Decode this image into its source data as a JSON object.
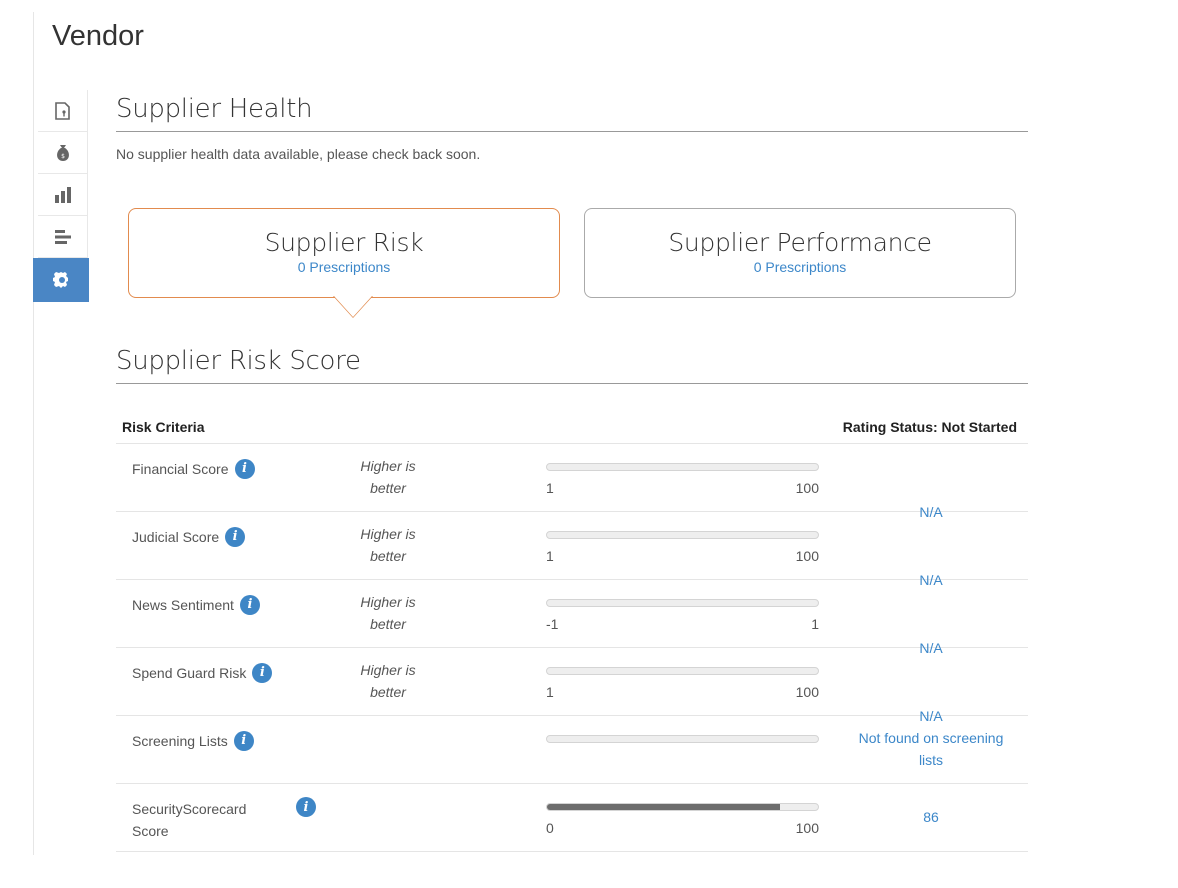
{
  "page": {
    "title": "Vendor"
  },
  "sidebar": {
    "items": [
      {
        "icon": "document-icon"
      },
      {
        "icon": "money-bag-icon"
      },
      {
        "icon": "bar-chart-icon"
      },
      {
        "icon": "horizontal-bars-icon"
      },
      {
        "icon": "gear-icon",
        "active": true
      }
    ]
  },
  "health": {
    "title": "Supplier Health",
    "note": "No supplier health data available, please check back soon."
  },
  "cards": {
    "risk": {
      "title": "Supplier Risk",
      "link": "0 Prescriptions"
    },
    "performance": {
      "title": "Supplier Performance",
      "link": "0 Prescriptions"
    }
  },
  "risk_score": {
    "title": "Supplier Risk Score",
    "header_left": "Risk Criteria",
    "header_right": "Rating Status: Not Started",
    "rows": [
      {
        "name": "Financial Score",
        "hint_line1": "Higher is",
        "hint_line2": "better",
        "min": "1",
        "max": "100",
        "fill": 0,
        "value": "N/A"
      },
      {
        "name": "Judicial Score",
        "hint_line1": "Higher is",
        "hint_line2": "better",
        "min": "1",
        "max": "100",
        "fill": 0,
        "value": "N/A"
      },
      {
        "name": "News Sentiment",
        "hint_line1": "Higher is",
        "hint_line2": "better",
        "min": "-1",
        "max": "1",
        "fill": 0,
        "value": "N/A"
      },
      {
        "name": "Spend Guard Risk",
        "hint_line1": "Higher is",
        "hint_line2": "better",
        "min": "1",
        "max": "100",
        "fill": 0,
        "value": "N/A"
      },
      {
        "name": "Screening Lists",
        "hint_line1": "",
        "hint_line2": "",
        "min": "",
        "max": "",
        "fill": 0,
        "value_line1": "Not found on screening",
        "value_line2": "lists"
      },
      {
        "name": "SecurityScorecard Score",
        "hint_line1": "",
        "hint_line2": "",
        "min": "0",
        "max": "100",
        "fill": 0.86,
        "value": "86"
      }
    ]
  },
  "colors": {
    "accent": "#3c87c9",
    "active_tab": "#4a86c5",
    "risk_card_border": "#e28b4e"
  }
}
